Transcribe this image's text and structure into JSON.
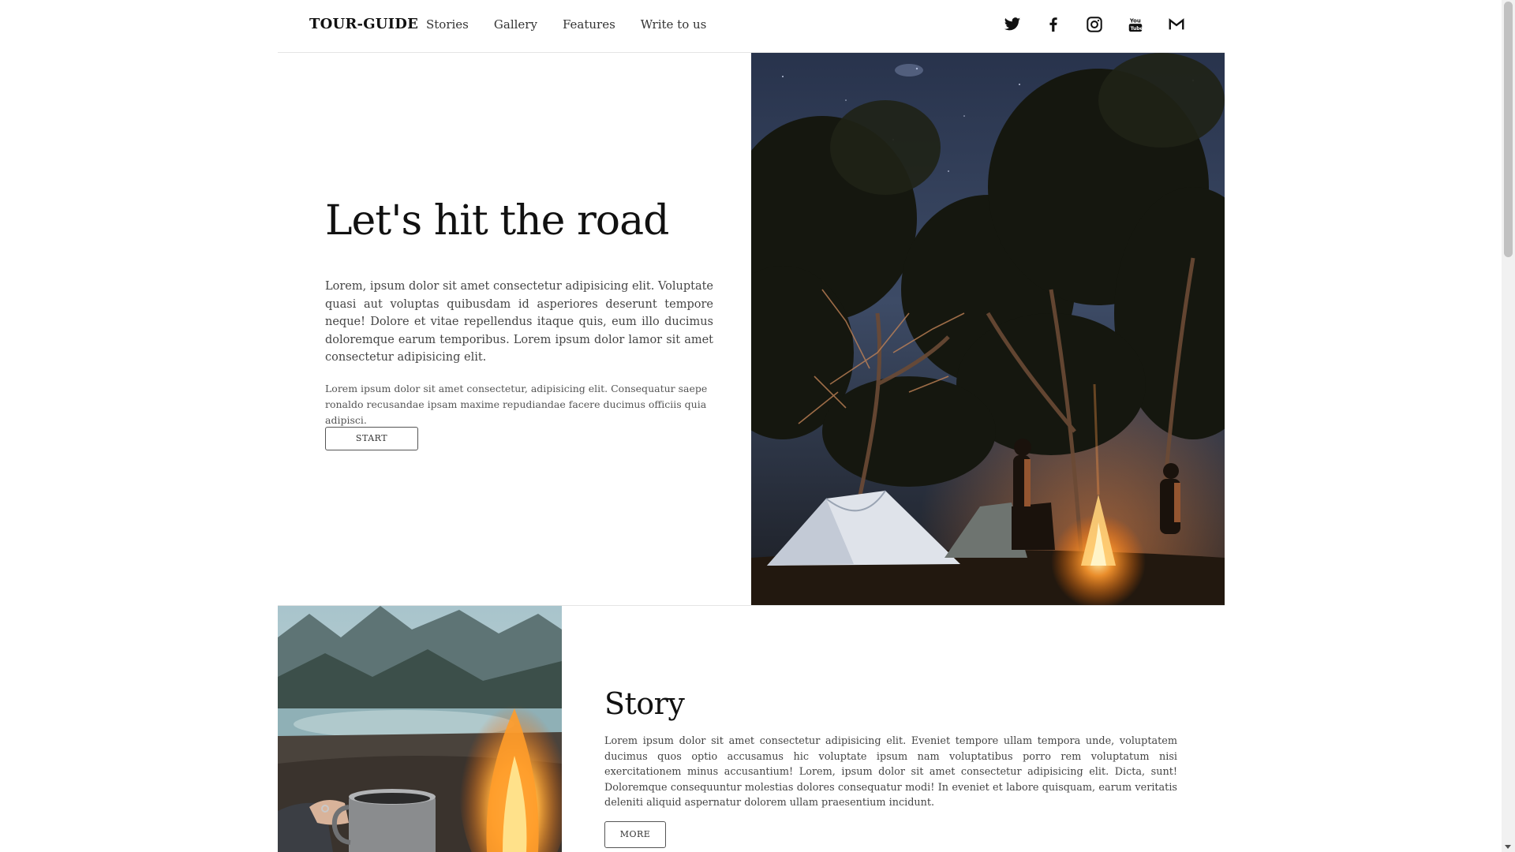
{
  "header": {
    "logo": "TOUR-GUIDE",
    "nav": [
      "Stories",
      "Gallery",
      "Features",
      "Write to us"
    ],
    "social_icons": [
      "twitter-icon",
      "facebook-icon",
      "instagram-icon",
      "youtube-icon",
      "gmail-icon"
    ]
  },
  "hero": {
    "title": "Let's hit the road",
    "paragraph1": "Lorem, ipsum dolor sit amet consectetur adipisicing elit. Voluptate quasi aut voluptas quibusdam id asperiores deserunt tempore neque! Dolore et vitae repellendus itaque quis, eum illo ducimus doloremque earum temporibus. Lorem ipsum dolor lamor sit amet consectetur adipisicing elit.",
    "paragraph2": "Lorem ipsum dolor sit amet consectetur, adipisicing elit. Consequatur saepe ronaldo recusandae ipsam maxime repudiandae facere ducimus officiis quia adipisci.",
    "button": "START",
    "image": "camping-tents-campfire-starry-night"
  },
  "story": {
    "title": "Story",
    "paragraph": "Lorem ipsum dolor sit amet consectetur adipisicing elit. Eveniet tempore ullam tempora unde, voluptatem ducimus quos optio accusamus hic voluptate ipsum nam voluptatibus porro rem voluptatum nisi exercitationem minus accusantium! Lorem, ipsum dolor sit amet consectetur adipisicing elit. Dicta, sunt! Doloremque consequuntur molestias dolores consequatur modi! In eveniet et labore quisquam, earum veritatis deleniti aliquid aspernatur dolorem ullam praesentium incidunt.",
    "button": "MORE",
    "image": "mug-by-campfire-mountain-lake"
  },
  "colors": {
    "text": "#222222",
    "divider": "#e5e5e5",
    "button_border": "#555555"
  }
}
